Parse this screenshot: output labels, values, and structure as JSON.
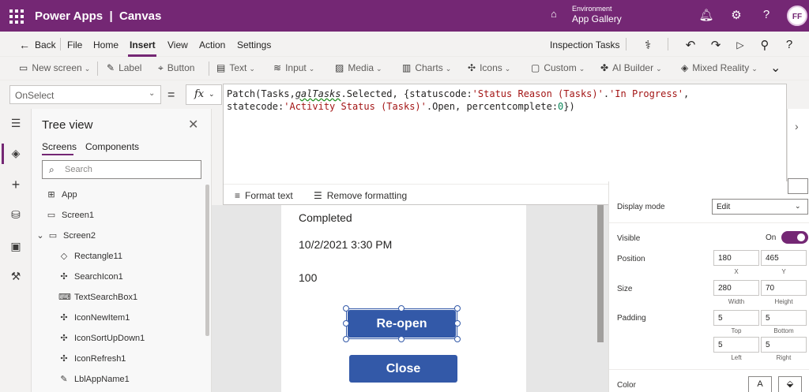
{
  "topbar": {
    "brand": "Power Apps  |  Canvas",
    "environment_label": "Environment",
    "environment_value": "App Gallery",
    "avatar_initials": "FF",
    "accent": "#742774"
  },
  "menu": {
    "back": "Back",
    "items": [
      "File",
      "Home",
      "Insert",
      "View",
      "Action",
      "Settings"
    ],
    "app_name": "Inspection Tasks"
  },
  "toolbar": {
    "items": [
      "New screen",
      "Label",
      "Button",
      "Text",
      "Input",
      "Media",
      "Charts",
      "Icons",
      "Custom",
      "AI Builder",
      "Mixed Reality"
    ]
  },
  "formula": {
    "property": "OnSelect",
    "equals": "=",
    "fx": "fx",
    "t1": "Patch(Tasks,",
    "t2": "galTasks",
    "t3": ".Selected, {statuscode:",
    "t4": "'Status Reason (Tasks)'",
    "t5": ".",
    "t6": "'In Progress'",
    "t7": ", statecode:",
    "t8": "'Activity Status (Tasks)'",
    "t9": ".Open, percentcomplete:",
    "t10": "0",
    "t11": "})",
    "format_text": "Format text",
    "remove_formatting": "Remove formatting"
  },
  "tree": {
    "title": "Tree view",
    "tab_screens": "Screens",
    "tab_components": "Components",
    "search_placeholder": "Search",
    "nodes": [
      "App",
      "Screen1",
      "Screen2",
      "Rectangle11",
      "SearchIcon1",
      "TextSearchBox1",
      "IconNewItem1",
      "IconSortUpDown1",
      "IconRefresh1",
      "LblAppName1"
    ]
  },
  "canvas": {
    "status": "Completed",
    "datetime": "10/2/2021 3:30 PM",
    "percent": "100",
    "reopen_label": "Re-open",
    "close_label": "Close",
    "button_color": "#3359a8"
  },
  "props": {
    "display_mode_label": "Display mode",
    "display_mode_value": "Edit",
    "visible_label": "Visible",
    "visible_state": "On",
    "position_label": "Position",
    "x": "180",
    "y": "465",
    "x_label": "X",
    "y_label": "Y",
    "size_label": "Size",
    "width": "280",
    "height": "70",
    "width_label": "Width",
    "height_label": "Height",
    "padding_label": "Padding",
    "pad_top": "5",
    "pad_bottom": "5",
    "pad_left": "5",
    "pad_right": "5",
    "top_label": "Top",
    "bottom_label": "Bottom",
    "left_label": "Left",
    "right_label": "Right",
    "color_label": "Color",
    "color_a": "A"
  }
}
